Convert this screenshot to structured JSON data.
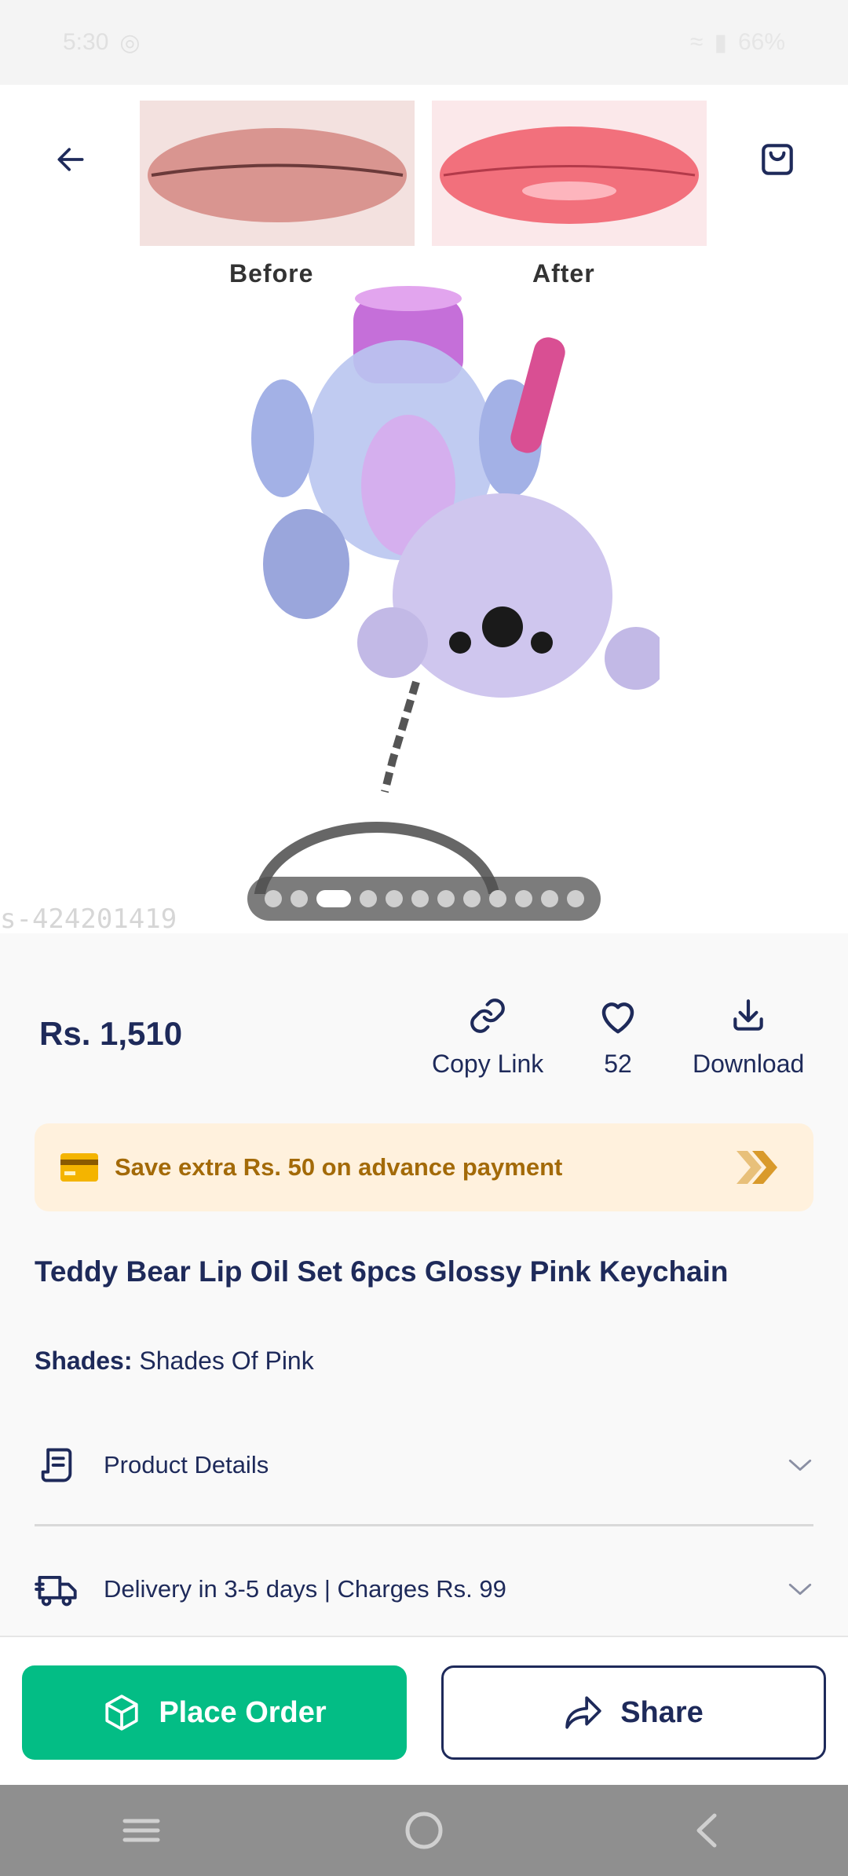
{
  "status_bar": {
    "time": "5:30",
    "battery": "66%"
  },
  "hero": {
    "before_label": "Before",
    "after_label": "After",
    "watermark": "s-424201419",
    "carousel": {
      "total": 12,
      "active_index": 2
    }
  },
  "price": "Rs. 1,510",
  "actions": {
    "copy_link": "Copy Link",
    "likes": "52",
    "download": "Download"
  },
  "banner": {
    "text": "Save extra Rs. 50 on advance payment"
  },
  "product": {
    "title": "Teddy Bear Lip Oil Set 6pcs Glossy Pink Keychain",
    "shades_label": "Shades:",
    "shades_value": "Shades Of Pink"
  },
  "sections": {
    "details": "Product Details",
    "delivery": "Delivery in 3-5 days | Charges Rs. 99"
  },
  "buttons": {
    "place_order": "Place Order",
    "share": "Share"
  },
  "colors": {
    "primary": "#03bd85",
    "navy": "#1e2a5a",
    "banner_bg": "#fff1dd",
    "banner_text": "#a36a08"
  }
}
